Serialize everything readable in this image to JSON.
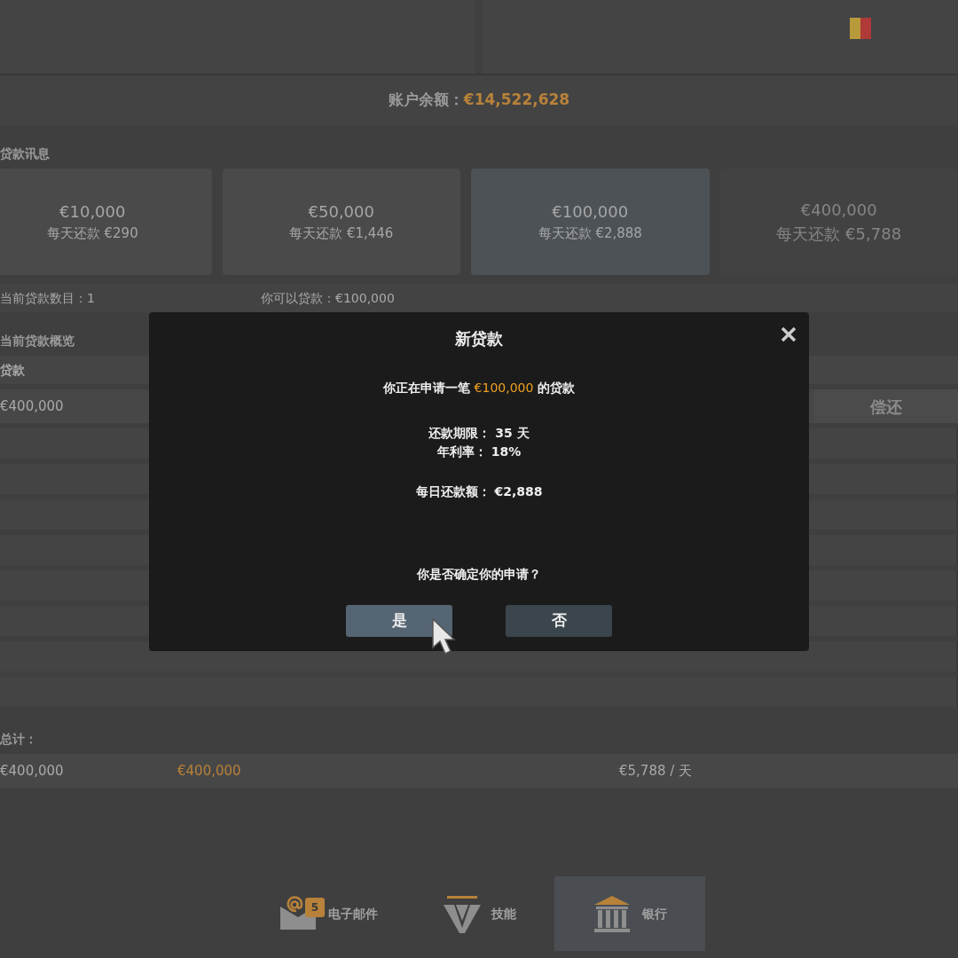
{
  "balance": {
    "label": "账户余额：",
    "amount": "€14,522,628"
  },
  "loan_info": {
    "title": "贷款讯息",
    "options": [
      {
        "amount": "€10,000",
        "daily": "每天还款 €290",
        "selected": false,
        "disabled": false
      },
      {
        "amount": "€50,000",
        "daily": "每天还款 €1,446",
        "selected": false,
        "disabled": false
      },
      {
        "amount": "€100,000",
        "daily": "每天还款 €2,888",
        "selected": true,
        "disabled": false
      },
      {
        "amount": "€400,000",
        "daily": "每天还款 €5,788",
        "selected": false,
        "disabled": true
      }
    ]
  },
  "status": {
    "loan_count": "当前贷款数目：1",
    "available": "你可以贷款：€100,000"
  },
  "overview": {
    "title": "当前贷款概览",
    "columns": [
      "贷款"
    ],
    "rows": [
      {
        "loan": "€400,000",
        "action": "偿还"
      }
    ],
    "totals": {
      "label": "总计：",
      "loan": "€400,000",
      "remaining": "€400,000",
      "installment": "€5,788 / 天"
    }
  },
  "modal": {
    "title": "新贷款",
    "message_prefix": "你正在申请一笔",
    "message_amount": "€100,000",
    "message_suffix": "的贷款",
    "details": [
      "还款期限： 35 天",
      "年利率： 18%"
    ],
    "daily": "每日还款额： €2,888",
    "question": "你是否确定你的申请？",
    "buttons": [
      {
        "label": "是",
        "highlighted": true
      },
      {
        "label": "否",
        "highlighted": false
      }
    ]
  },
  "nav": [
    {
      "kind": "email",
      "label": "电子邮件",
      "badge": "5",
      "selected": false
    },
    {
      "kind": "skills",
      "label": "技能",
      "selected": false
    },
    {
      "kind": "bank",
      "label": "银行",
      "selected": true
    }
  ]
}
